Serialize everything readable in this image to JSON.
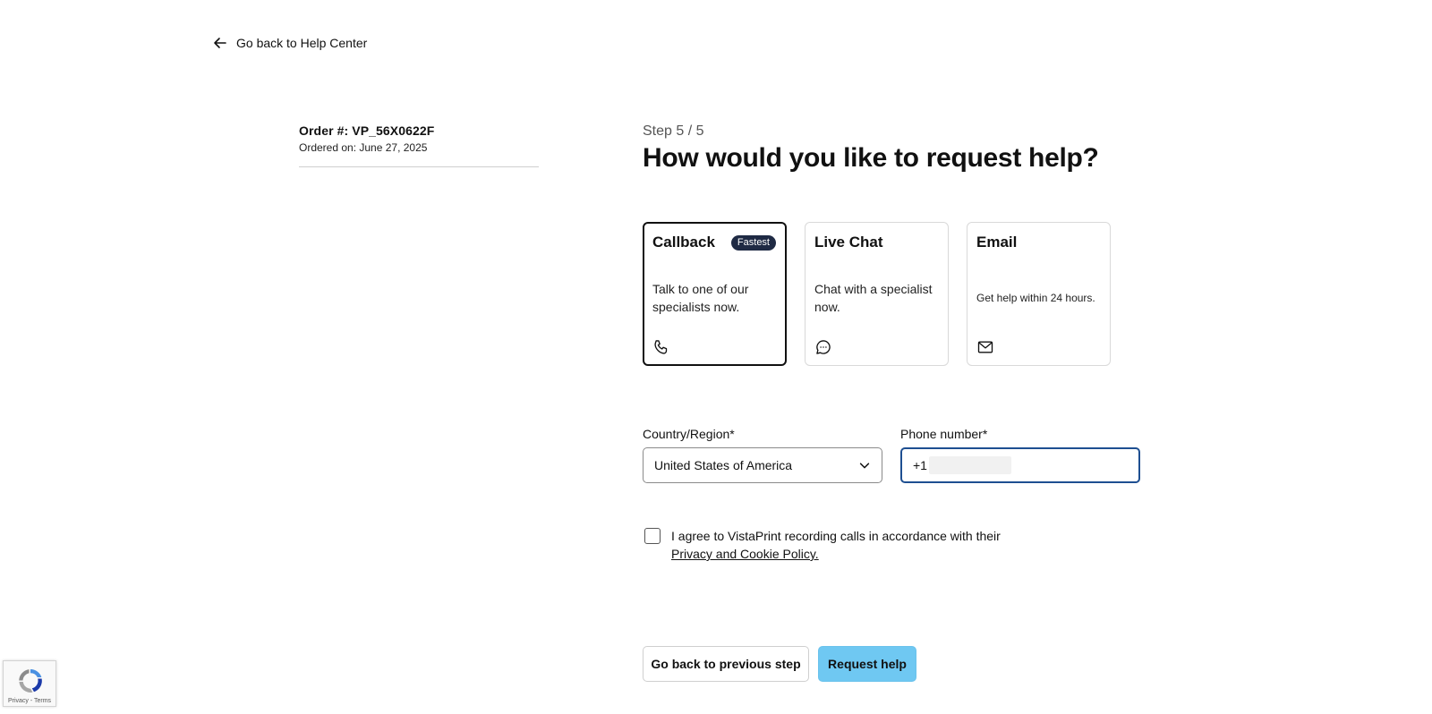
{
  "nav": {
    "back_to_help": "Go back to Help Center"
  },
  "order": {
    "number": "Order #: VP_56X0622F",
    "date": "Ordered on: June 27, 2025"
  },
  "wizard": {
    "step": "Step 5 / 5",
    "title": "How would you like to request help?"
  },
  "options": [
    {
      "title": "Callback",
      "badge": "Fastest",
      "description": "Talk to one of our specialists now.",
      "icon": "phone-icon",
      "selected": true
    },
    {
      "title": "Live Chat",
      "description": "Chat with a specialist now.",
      "icon": "chat-bubble-icon",
      "selected": false
    },
    {
      "title": "Email",
      "description": "Get help within 24 hours.",
      "icon": "mail-icon",
      "selected": false
    }
  ],
  "form": {
    "country_label": "Country/Region*",
    "country_value": "United States of America",
    "phone_label": "Phone number*",
    "phone_prefix": "+1"
  },
  "consent": {
    "text": "I agree to VistaPrint recording calls in accordance with their",
    "link": "Privacy and Cookie Policy.",
    "checked": false
  },
  "actions": {
    "back_label": "Go back to previous step",
    "submit_label": "Request help"
  },
  "recaptcha": {
    "terms": "Privacy - Terms"
  },
  "colors": {
    "primary_button": "#6fc8f2",
    "badge_bg": "#1f2a44",
    "focus_border": "#1e4f91"
  }
}
